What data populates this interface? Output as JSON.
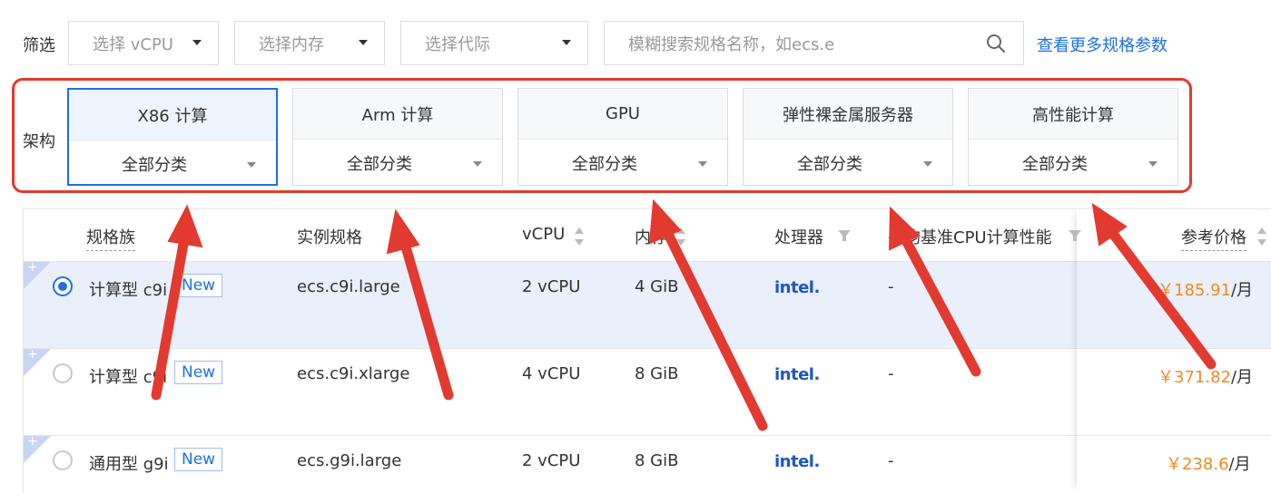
{
  "filters": {
    "label": "筛选",
    "vcpu_placeholder": "选择 vCPU",
    "memory_placeholder": "选择内存",
    "generation_placeholder": "选择代际",
    "search_placeholder": "模糊搜索规格名称，如ecs.e",
    "more_link": "查看更多规格参数"
  },
  "architecture": {
    "label": "架构",
    "options": [
      {
        "name": "X86 计算",
        "sub": "全部分类",
        "active": true
      },
      {
        "name": "Arm 计算",
        "sub": "全部分类"
      },
      {
        "name": "GPU",
        "sub": "全部分类"
      },
      {
        "name": "弹性裸金属服务器",
        "sub": "全部分类"
      },
      {
        "name": "高性能计算",
        "sub": "全部分类"
      }
    ]
  },
  "table": {
    "headers": {
      "family": "规格族",
      "instance": "实例规格",
      "vcpu": "vCPU",
      "memory": "内存",
      "processor": "处理器",
      "baseline": "平均基准CPU计算性能",
      "price": "参考价格"
    },
    "rows": [
      {
        "family": "计算型 c9i",
        "badge": "New",
        "instance": "ecs.c9i.large",
        "vcpu": "2 vCPU",
        "memory": "4 GiB",
        "processor": "intel.",
        "baseline": "-",
        "price": "￥185.91",
        "unit": "/月",
        "selected": true
      },
      {
        "family": "计算型 c9i",
        "badge": "New",
        "instance": "ecs.c9i.xlarge",
        "vcpu": "4 vCPU",
        "memory": "8 GiB",
        "processor": "intel.",
        "baseline": "-",
        "price": "￥371.82",
        "unit": "/月"
      },
      {
        "family": "通用型 g9i",
        "badge": "New",
        "instance": "ecs.g9i.large",
        "vcpu": "2 vCPU",
        "memory": "8 GiB",
        "processor": "intel.",
        "baseline": "-",
        "price": "￥238.6",
        "unit": "/月"
      }
    ]
  },
  "colors": {
    "accent": "#1f6fe5",
    "annotation_red": "#e23a2f",
    "price_orange": "#f08a24"
  }
}
